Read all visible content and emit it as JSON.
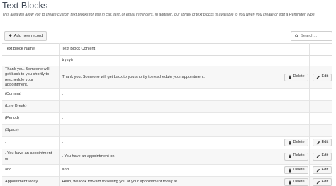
{
  "page": {
    "title": "Text Blocks",
    "description": "This area will allow you to create custom text blocks for use in call, text, or email reminders. In addition, our library of text blocks is available to you when you create or edit a Reminder Type."
  },
  "toolbar": {
    "add_label": "Add new record",
    "add_icon": "plus-icon",
    "search_placeholder": "Search...",
    "search_icon": "search-icon"
  },
  "table": {
    "columns": [
      "Text Block Name",
      "Text Block Content",
      "",
      ""
    ],
    "delete_label": "Delete",
    "edit_label": "Edit",
    "rows": [
      {
        "name": "",
        "content": "trytrytr",
        "actions": false
      },
      {
        "name": "Thank you. Someone will get back to you shortly to reschedule your appointment.",
        "content": "Thank you. Someone will get back to you shortly to reschedule your appointment.",
        "actions": true
      },
      {
        "name": "(Comma)",
        "content": ",",
        "actions": false
      },
      {
        "name": "(Line Break)",
        "content": "",
        "actions": false
      },
      {
        "name": "(Period)",
        "content": ".",
        "actions": false
      },
      {
        "name": "(Space)",
        "content": "",
        "actions": false
      },
      {
        "name": ".",
        "content": ".",
        "actions": true
      },
      {
        "name": ". You have an appointment on",
        "content": ". You have an appointment on",
        "actions": true
      },
      {
        "name": "and",
        "content": "and",
        "actions": true
      },
      {
        "name": "AppointmentToday",
        "content": "Hello, we look forward to seeing you at your appointment today at",
        "actions": true
      }
    ]
  }
}
